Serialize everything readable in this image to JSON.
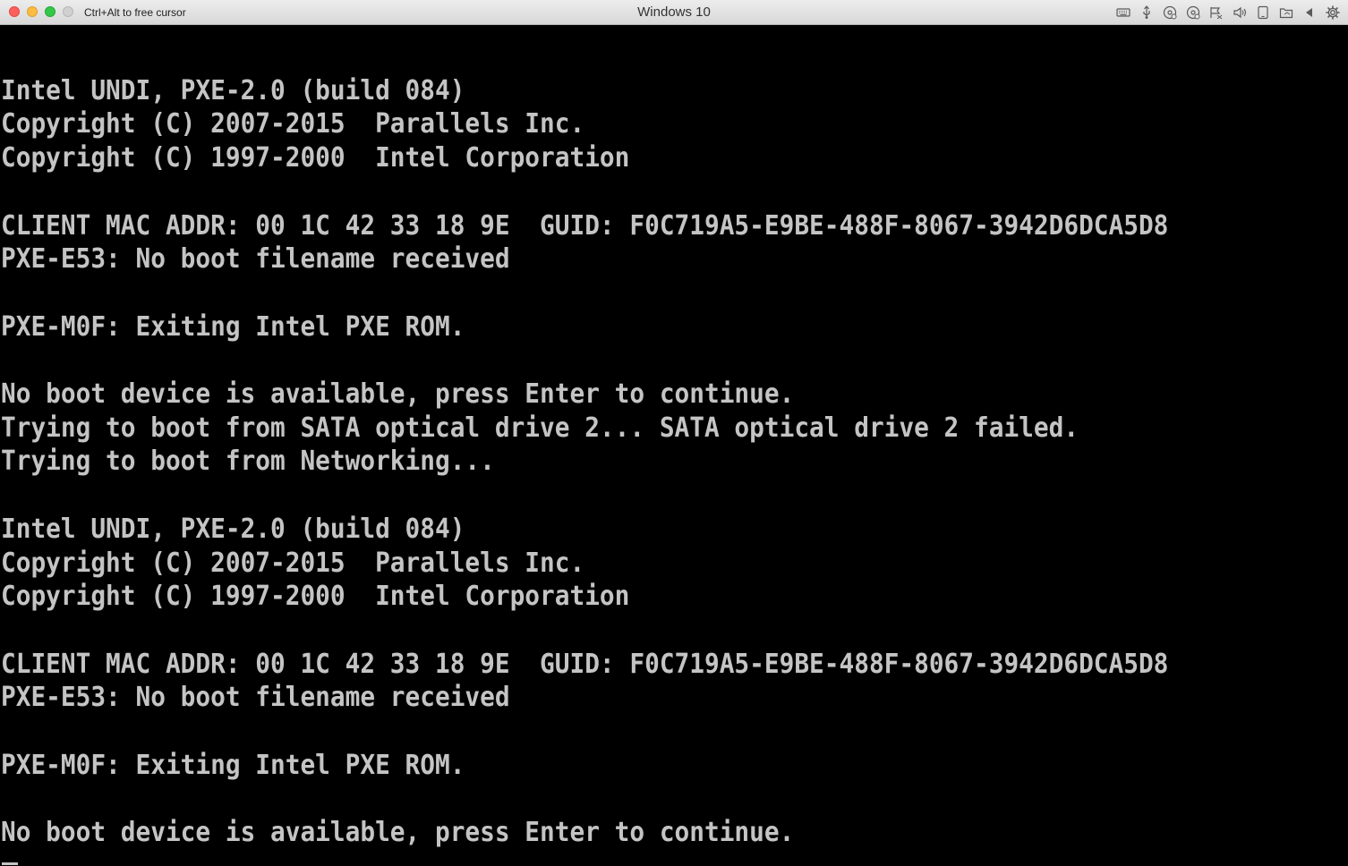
{
  "window": {
    "title": "Windows 10",
    "cursor_hint": "Ctrl+Alt to free cursor",
    "traffic_lights": {
      "close": "#fc605c",
      "minimize": "#fdbc40",
      "maximize": "#34c84a"
    },
    "toolbar_icons": [
      "keyboard-icon",
      "usb-icon",
      "cd-dvd-icon",
      "cd-dvd-2-icon",
      "network-icon",
      "sound-icon",
      "tablet-icon",
      "shared-folder-icon",
      "collapse-arrow-icon",
      "settings-gear-icon"
    ]
  },
  "console": {
    "text_color": "#c4c4c4",
    "background": "#000000",
    "lines": [
      "",
      "Intel UNDI, PXE-2.0 (build 084)",
      "Copyright (C) 2007-2015  Parallels Inc.",
      "Copyright (C) 1997-2000  Intel Corporation",
      "",
      "CLIENT MAC ADDR: 00 1C 42 33 18 9E  GUID: F0C719A5-E9BE-488F-8067-3942D6DCA5D8",
      "PXE-E53: No boot filename received",
      "",
      "PXE-M0F: Exiting Intel PXE ROM.",
      "",
      "No boot device is available, press Enter to continue.",
      "Trying to boot from SATA optical drive 2... SATA optical drive 2 failed.",
      "Trying to boot from Networking...",
      "",
      "Intel UNDI, PXE-2.0 (build 084)",
      "Copyright (C) 2007-2015  Parallels Inc.",
      "Copyright (C) 1997-2000  Intel Corporation",
      "",
      "CLIENT MAC ADDR: 00 1C 42 33 18 9E  GUID: F0C719A5-E9BE-488F-8067-3942D6DCA5D8",
      "PXE-E53: No boot filename received",
      "",
      "PXE-M0F: Exiting Intel PXE ROM.",
      "",
      "No boot device is available, press Enter to continue.",
      ""
    ]
  }
}
